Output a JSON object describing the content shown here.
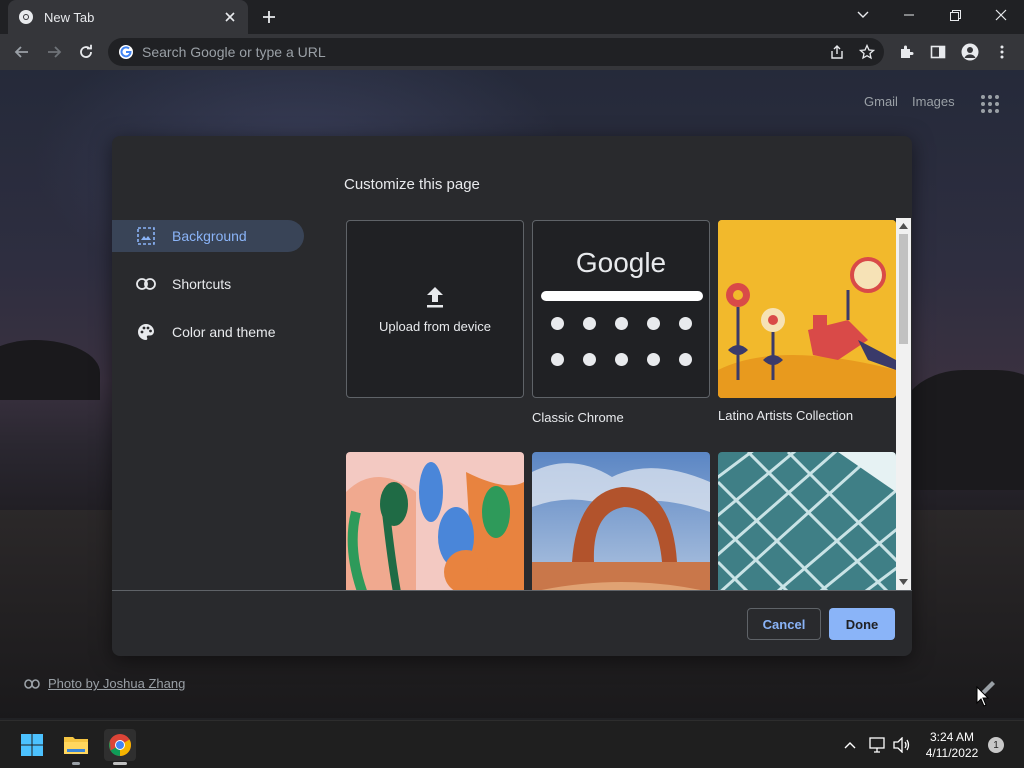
{
  "browser": {
    "tab_title": "New Tab",
    "omnibox_placeholder": "Search Google or type a URL"
  },
  "ntp": {
    "links": [
      "Gmail",
      "Images"
    ],
    "photo_credit": "Photo by Joshua Zhang"
  },
  "dialog": {
    "title": "Customize this page",
    "sidebar": [
      {
        "label": "Background",
        "icon": "image-icon",
        "active": true
      },
      {
        "label": "Shortcuts",
        "icon": "link-icon",
        "active": false
      },
      {
        "label": "Color and theme",
        "icon": "palette-icon",
        "active": false
      }
    ],
    "tiles": [
      {
        "label": "Upload from device"
      },
      {
        "label": "Classic Chrome",
        "logo_text": "Google"
      },
      {
        "label": "Latino Artists Collection"
      }
    ],
    "buttons": {
      "cancel": "Cancel",
      "done": "Done"
    }
  },
  "taskbar": {
    "time": "3:24 AM",
    "date": "4/11/2022",
    "notification_count": "1"
  },
  "colors": {
    "accent": "#8ab4f8",
    "dialog_bg": "#292a2d",
    "active_item_bg": "#394457"
  }
}
